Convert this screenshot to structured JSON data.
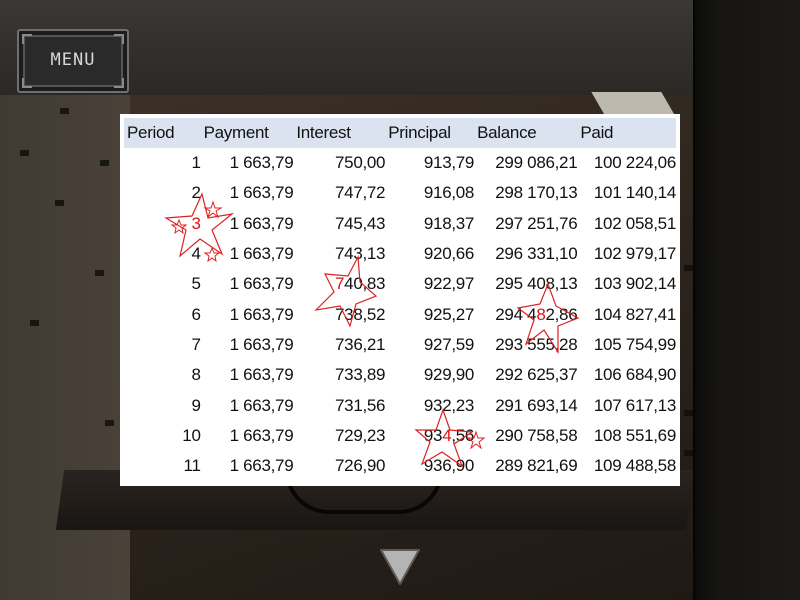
{
  "menu": {
    "label": "MENU"
  },
  "table": {
    "headers": [
      "Period",
      "Payment",
      "Interest",
      "Principal",
      "Balance",
      "Paid"
    ],
    "rows": [
      [
        "1",
        "1 663,79",
        "750,00",
        "913,79",
        "299 086,21",
        "100 224,06"
      ],
      [
        "2",
        "1 663,79",
        "747,72",
        "916,08",
        "298 170,13",
        "101 140,14"
      ],
      [
        "3",
        "1 663,79",
        "745,43",
        "918,37",
        "297 251,76",
        "102 058,51"
      ],
      [
        "4",
        "1 663,79",
        "743,13",
        "920,66",
        "296 331,10",
        "102 979,17"
      ],
      [
        "5",
        "1 663,79",
        "740,83",
        "922,97",
        "295 408,13",
        "103 902,14"
      ],
      [
        "6",
        "1 663,79",
        "738,52",
        "925,27",
        "294 482,86",
        "104 827,41"
      ],
      [
        "7",
        "1 663,79",
        "736,21",
        "927,59",
        "293 555,28",
        "105 754,99"
      ],
      [
        "8",
        "1 663,79",
        "733,89",
        "929,90",
        "292 625,37",
        "106 684,90"
      ],
      [
        "9",
        "1 663,79",
        "731,56",
        "932,23",
        "291 693,14",
        "107 617,13"
      ],
      [
        "10",
        "1 663,79",
        "729,23",
        "934,56",
        "290 758,58",
        "108 551,69"
      ],
      [
        "11",
        "1 663,79",
        "726,90",
        "936,90",
        "289 821,69",
        "109 488,58"
      ]
    ]
  },
  "highlights": [
    {
      "row": 2,
      "col": 0,
      "char_index": 0,
      "color": "#dd1111"
    },
    {
      "row": 4,
      "col": 2,
      "char_index": 0,
      "color": "#dd1111"
    },
    {
      "row": 5,
      "col": 4,
      "char_index": 5,
      "color": "#dd1111"
    },
    {
      "row": 9,
      "col": 3,
      "char_index": 2,
      "color": "#dd1111"
    }
  ],
  "icons": {
    "navigate_down": "down-arrow-icon",
    "star_mark": "star-icon"
  },
  "colors": {
    "header_bg": "#dbe3f1",
    "mark_red": "#dd1111"
  }
}
